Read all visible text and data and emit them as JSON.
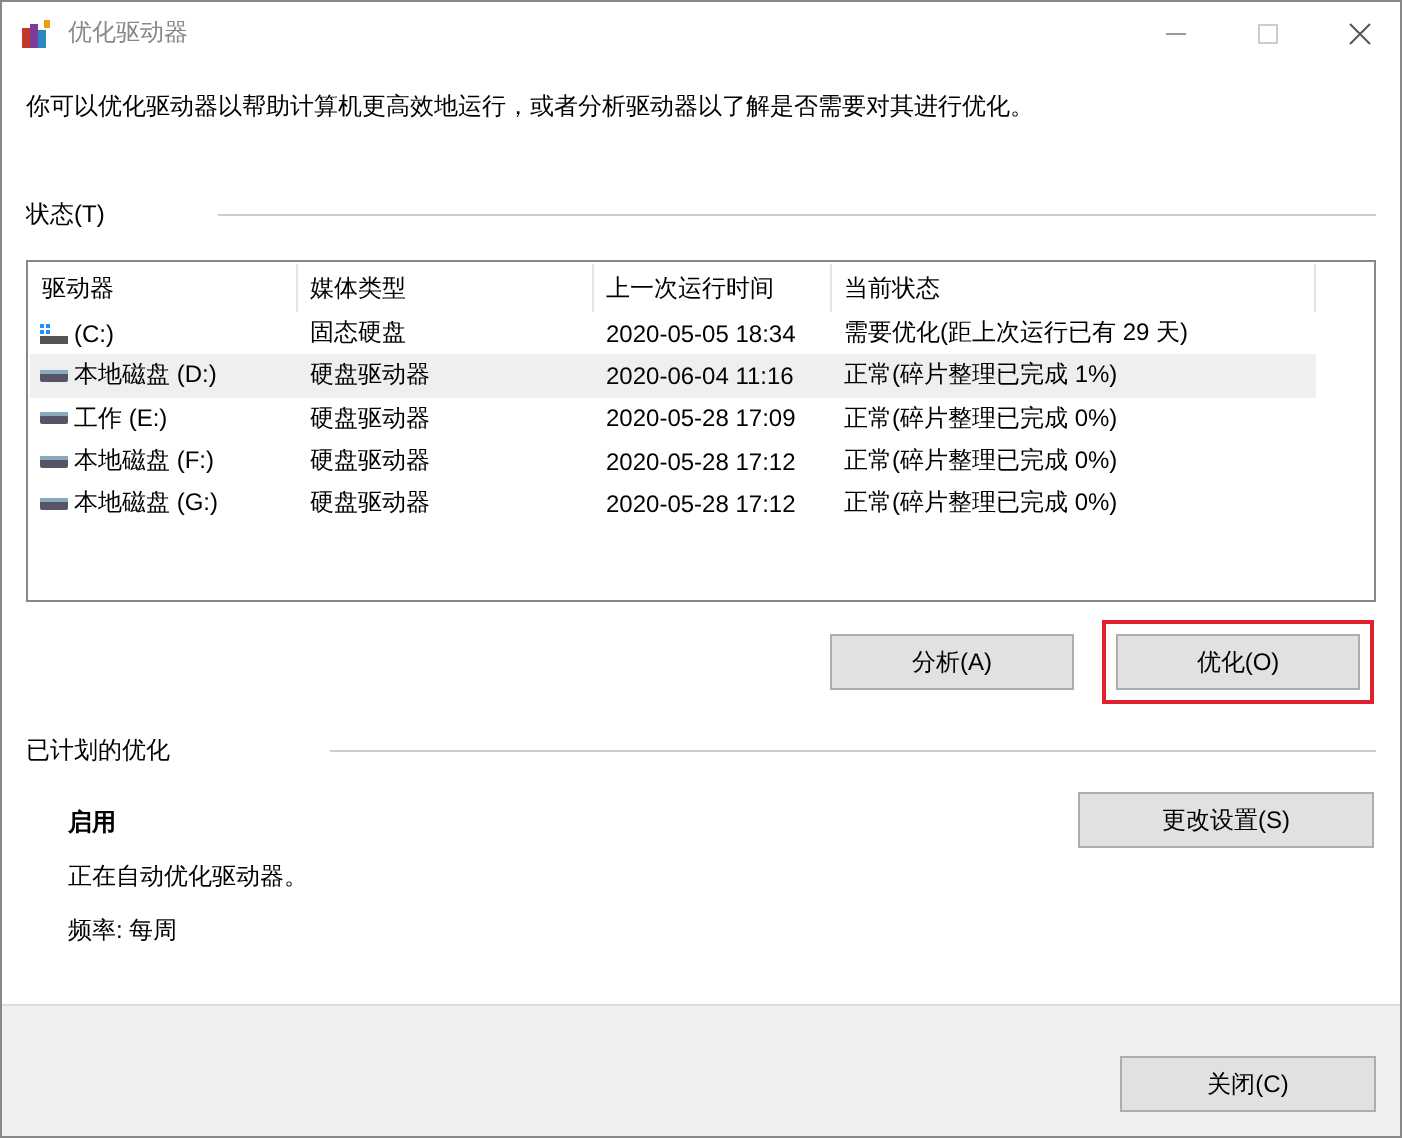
{
  "window": {
    "title": "优化驱动器"
  },
  "description": "你可以优化驱动器以帮助计算机更高效地运行，或者分析驱动器以了解是否需要对其进行优化。",
  "status_section": {
    "label": "状态(T)",
    "table": {
      "columns": [
        "驱动器",
        "媒体类型",
        "上一次运行时间",
        "当前状态"
      ],
      "rows": [
        {
          "kind": "system",
          "drive": "(C:)",
          "media": "固态硬盘",
          "last_run": "2020-05-05 18:34",
          "status": "需要优化(距上次运行已有 29 天)",
          "selected": false
        },
        {
          "kind": "disk",
          "drive": "本地磁盘 (D:)",
          "media": "硬盘驱动器",
          "last_run": "2020-06-04 11:16",
          "status": "正常(碎片整理已完成 1%)",
          "selected": true
        },
        {
          "kind": "disk",
          "drive": "工作 (E:)",
          "media": "硬盘驱动器",
          "last_run": "2020-05-28 17:09",
          "status": "正常(碎片整理已完成 0%)",
          "selected": false
        },
        {
          "kind": "disk",
          "drive": "本地磁盘 (F:)",
          "media": "硬盘驱动器",
          "last_run": "2020-05-28 17:12",
          "status": "正常(碎片整理已完成 0%)",
          "selected": false
        },
        {
          "kind": "disk",
          "drive": "本地磁盘 (G:)",
          "media": "硬盘驱动器",
          "last_run": "2020-05-28 17:12",
          "status": "正常(碎片整理已完成 0%)",
          "selected": false
        }
      ]
    },
    "buttons": [
      {
        "label": "分析(A)",
        "highlighted": false
      },
      {
        "label": "优化(O)",
        "highlighted": true
      }
    ]
  },
  "schedule": {
    "label": "已计划的优化",
    "state": "启用",
    "description": "正在自动优化驱动器。",
    "frequency": "频率: 每周",
    "button": "更改设置(S)"
  },
  "footer": {
    "button": "关闭(C)"
  }
}
